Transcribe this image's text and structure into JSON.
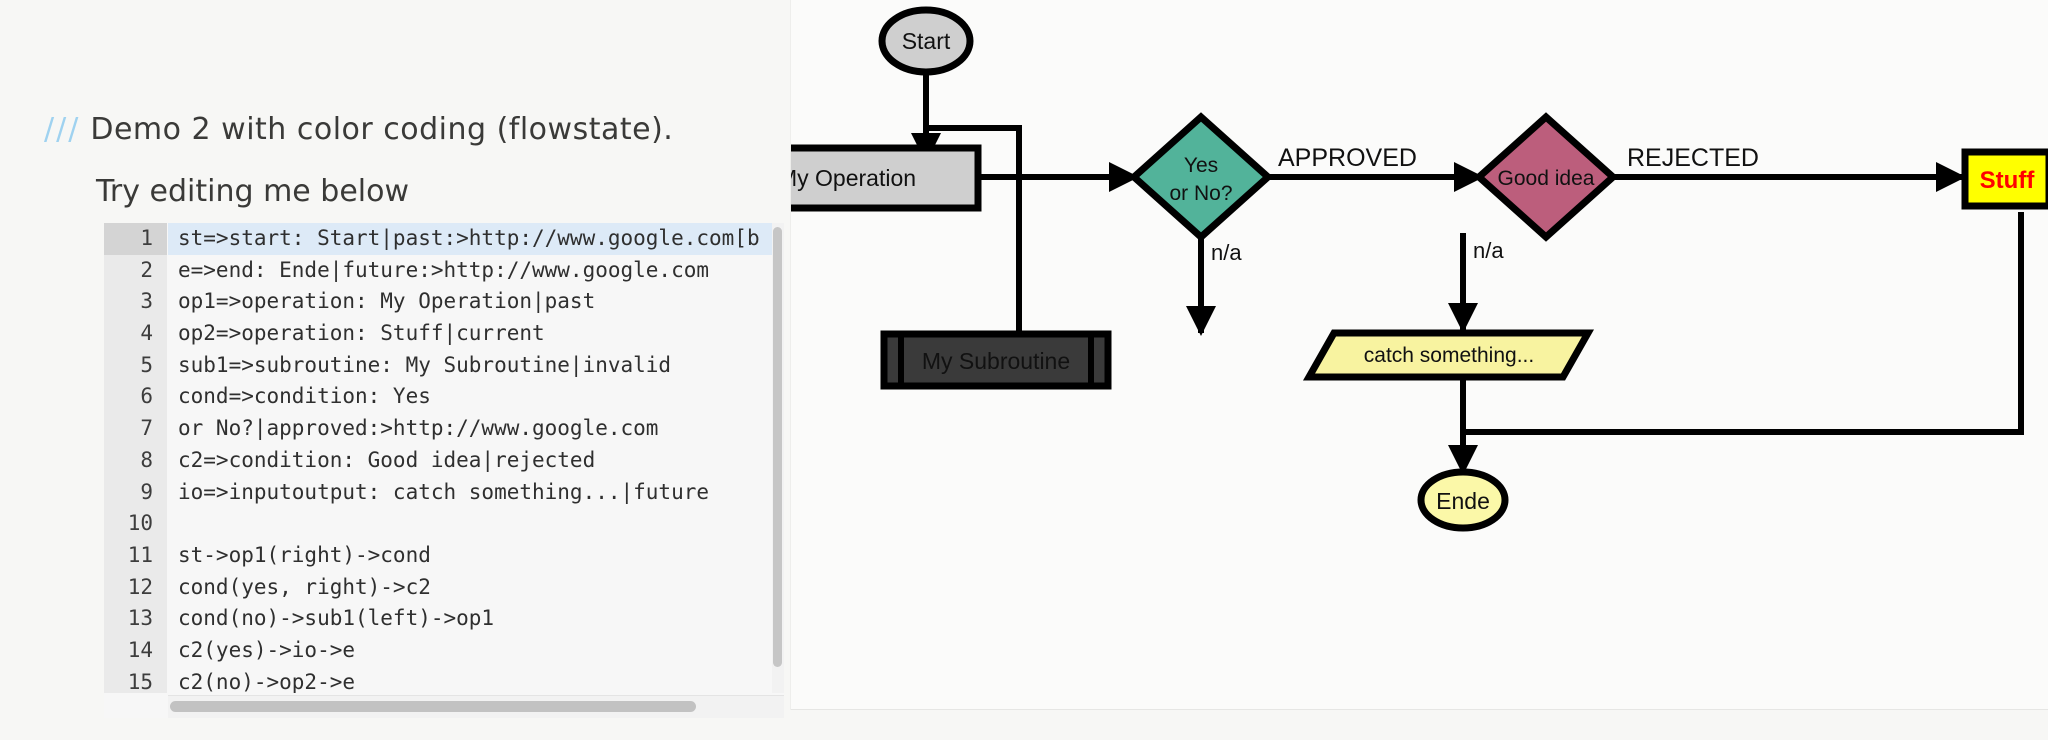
{
  "editor": {
    "heading_slashes": "///",
    "heading_text": "Demo 2 with color coding (flowstate).",
    "subheading": "Try editing me below",
    "active_line": 1,
    "lines": [
      {
        "n": "1",
        "text": "st=>start: Start|past:>http://www.google.com[b"
      },
      {
        "n": "2",
        "text": "e=>end: Ende|future:>http://www.google.com"
      },
      {
        "n": "3",
        "text": "op1=>operation: My Operation|past"
      },
      {
        "n": "4",
        "text": "op2=>operation: Stuff|current"
      },
      {
        "n": "5",
        "text": "sub1=>subroutine: My Subroutine|invalid"
      },
      {
        "n": "6",
        "text": "cond=>condition: Yes"
      },
      {
        "n": "7",
        "text": "or No?|approved:>http://www.google.com"
      },
      {
        "n": "8",
        "text": "c2=>condition: Good idea|rejected"
      },
      {
        "n": "9",
        "text": "io=>inputoutput: catch something...|future"
      },
      {
        "n": "10",
        "text": ""
      },
      {
        "n": "11",
        "text": "st->op1(right)->cond"
      },
      {
        "n": "12",
        "text": "cond(yes, right)->c2"
      },
      {
        "n": "13",
        "text": "cond(no)->sub1(left)->op1"
      },
      {
        "n": "14",
        "text": "c2(yes)->io->e"
      },
      {
        "n": "15",
        "text": "c2(no)->op2->e"
      }
    ]
  },
  "flowchart": {
    "nodes": {
      "start": {
        "label": "Start",
        "shape": "ellipse",
        "fill": "#cfcfcf",
        "text_color": "#111111"
      },
      "operation": {
        "label": "My Operation",
        "shape": "rectangle",
        "fill": "#cfcfcf",
        "text_color": "#111111"
      },
      "condition1": {
        "label_line1": "Yes",
        "label_line2": "or No?",
        "shape": "diamond",
        "fill": "#52b39a",
        "text_color": "#111111"
      },
      "condition2": {
        "label": "Good idea",
        "shape": "diamond",
        "fill": "#bc5e7c",
        "text_color": "#111111"
      },
      "stuff": {
        "label": "Stuff",
        "shape": "rectangle",
        "fill": "#ffff00",
        "text_color": "#ff0000"
      },
      "subroutine": {
        "label": "My Subroutine",
        "shape": "subroutine",
        "fill": "#3a3a3a",
        "text_color": "#111111"
      },
      "inputoutput": {
        "label": "catch something...",
        "shape": "parallelogram",
        "fill": "#f8f3a0",
        "text_color": "#111111"
      },
      "end": {
        "label": "Ende",
        "shape": "ellipse",
        "fill": "#fbf8a8",
        "text_color": "#111111"
      }
    },
    "edge_labels": {
      "approved": "APPROVED",
      "rejected": "REJECTED",
      "cond1_no": "n/a",
      "cond2_no": "n/a"
    }
  }
}
